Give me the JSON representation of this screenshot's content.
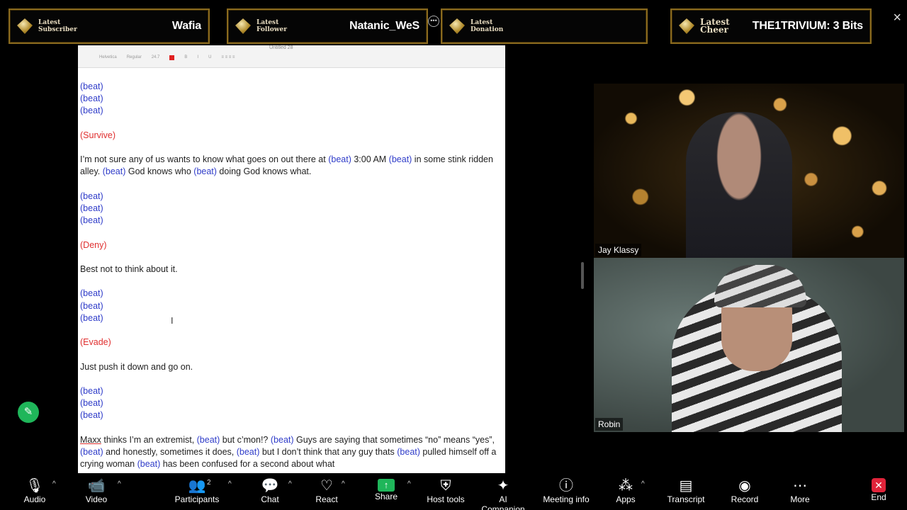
{
  "overlay": {
    "subscriber": {
      "caption_1": "Latest",
      "caption_2": "Subscriber",
      "value": "Wafia"
    },
    "follower": {
      "caption_1": "Latest",
      "caption_2": "Follower",
      "value": "Natanic_WeS"
    },
    "donation": {
      "caption_1": "Latest",
      "caption_2": "Donation",
      "value": ""
    },
    "cheer": {
      "caption_1": "Latest",
      "caption_2": "Cheer",
      "value": "THE1TRIVIUM: 3 Bits"
    },
    "close_icon": "×"
  },
  "document": {
    "title": "Untitled 28",
    "toolbar_font": "Helvetica",
    "toolbar_style": "Regular",
    "toolbar_size": "24.7",
    "lines": {
      "b1": "(beat)",
      "b2": "(beat)",
      "b3": "(beat)",
      "survive": "(Survive)",
      "p1_a": "I’m not sure any of us wants to know what goes on out there at ",
      "p1_b": "(beat)",
      "p1_c": " 3:00 AM ",
      "p1_d": "(beat)",
      "p1_e": " in some stink ridden alley. ",
      "p1_f": "(beat)",
      "p1_g": " God knows who ",
      "p1_h": "(beat)",
      "p1_i": " doing God knows what.",
      "b4": "(beat)",
      "b5": "(beat)",
      "b6": "(beat)",
      "deny": "(Deny)",
      "p2": "Best not to think about it.",
      "b7": "(beat)",
      "b8": "(beat)",
      "b9": "(beat)",
      "evade": "(Evade)",
      "p3": "Just push it down and go on.",
      "b10": "(beat)",
      "b11": "(beat)",
      "b12": "(beat)",
      "p4_a": "Maxx",
      "p4_b": " thinks I’m an extremist, ",
      "p4_c": "(beat)",
      "p4_d": " but c’mon!? ",
      "p4_e": "(beat)",
      "p4_f": " Guys are saying that sometimes “no” means “yes”, ",
      "p4_g": "(beat)",
      "p4_h": " and honestly, sometimes it does, ",
      "p4_i": "(beat)",
      "p4_j": " but I don’t think that any guy thats ",
      "p4_k": "(beat)",
      "p4_l": " pulled himself off a crying woman ",
      "p4_m": "(beat)",
      "p4_n": " has been confused for a second about what"
    }
  },
  "participants": {
    "tile1_name": "Jay Klassy",
    "tile2_name": "Robin"
  },
  "toolbar": {
    "audio": "Audio",
    "video": "Video",
    "participants": "Participants",
    "participants_count": "2",
    "chat": "Chat",
    "react": "React",
    "share": "Share",
    "host_tools": "Host tools",
    "ai_companion": "AI Companion",
    "meeting_info": "Meeting info",
    "apps": "Apps",
    "transcript": "Transcript",
    "record": "Record",
    "more": "More",
    "end": "End"
  },
  "colors": {
    "beat": "#2f3cc9",
    "tag": "#e03030",
    "share_green": "#1fb65a",
    "end_red": "#e0243a",
    "overlay_border": "#8a6a1e"
  }
}
